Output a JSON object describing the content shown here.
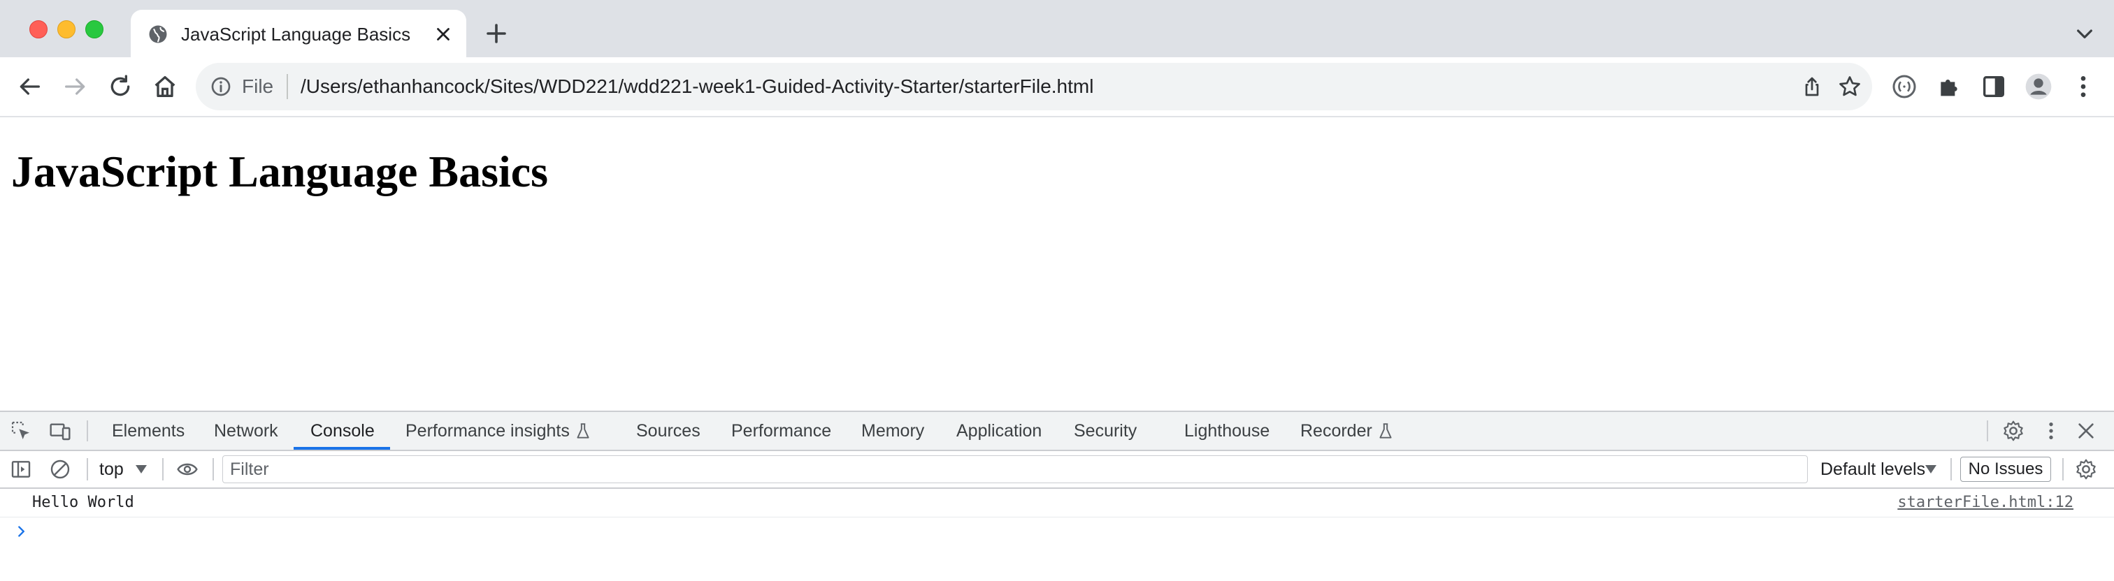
{
  "browser": {
    "tab": {
      "title": "JavaScript Language Basics",
      "favicon_icon": "globe-icon"
    },
    "toolbar": {
      "scheme_label": "File",
      "url": "/Users/ethanhancock/Sites/WDD221/wdd221-week1-Guided-Activity-Starter/starterFile.html"
    }
  },
  "page": {
    "heading": "JavaScript Language Basics"
  },
  "devtools": {
    "tabs": [
      {
        "label": "Elements"
      },
      {
        "label": "Network"
      },
      {
        "label": "Console",
        "active": true
      },
      {
        "label": "Performance insights",
        "icon": "flask-icon"
      },
      {
        "label": "Sources"
      },
      {
        "label": "Performance"
      },
      {
        "label": "Memory"
      },
      {
        "label": "Application"
      },
      {
        "label": "Security"
      },
      {
        "label": "Lighthouse"
      },
      {
        "label": "Recorder",
        "icon": "flask-icon"
      }
    ],
    "console_toolbar": {
      "context": "top",
      "filter_placeholder": "Filter",
      "levels": "Default levels",
      "issues": "No Issues"
    },
    "messages": [
      {
        "text": "Hello World",
        "source": "starterFile.html:12"
      }
    ]
  },
  "colors": {
    "tabstrip_bg": "#dee1e6",
    "omnibox_bg": "#f1f3f4",
    "devtools_bar_bg": "#f1f3f4",
    "accent_blue": "#1a73e8"
  }
}
